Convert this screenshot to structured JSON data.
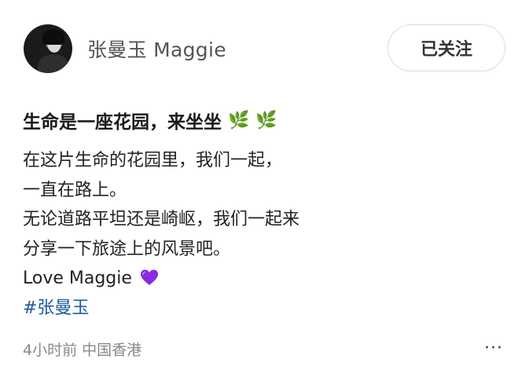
{
  "header": {
    "username": "张曼玉 Maggie",
    "follow_label": "已关注"
  },
  "post": {
    "title": "生命是一座花园，来坐坐",
    "title_emojis": [
      "🌿",
      "🌿"
    ],
    "lines": [
      "在这片生命的花园里，我们一起，",
      "一直在路上。",
      "无论道路平坦还是崎岖，我们一起来",
      "分享一下旅途上的风景吧。",
      "Love Maggie"
    ],
    "heart_emoji": "purple-heart-icon",
    "hashtag": "#张曼玉",
    "meta": "4小时前 中国香港",
    "more_label": "···"
  },
  "colors": {
    "hashtag": "#1e5a9c",
    "heart": "#8a2be2",
    "leaf": "#7cae3a"
  }
}
